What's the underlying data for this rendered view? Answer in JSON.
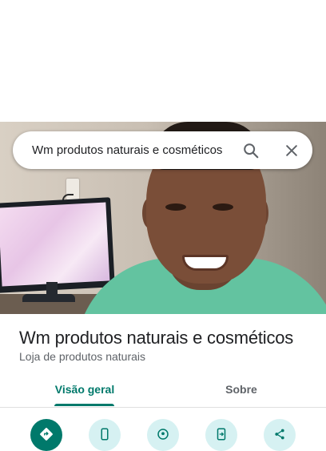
{
  "search": {
    "query": "Wm produtos naturais e cosméticos",
    "search_icon": "search-icon",
    "close_icon": "close-icon"
  },
  "place": {
    "title": "Wm produtos naturais e cosméticos",
    "category": "Loja de produtos naturais"
  },
  "tabs": [
    {
      "label": "Visão geral",
      "selected": true
    },
    {
      "label": "Sobre",
      "selected": false
    }
  ],
  "actions": [
    {
      "icon": "directions-icon"
    },
    {
      "icon": "phone-icon"
    },
    {
      "icon": "location-pin-icon"
    },
    {
      "icon": "send-to-phone-icon"
    },
    {
      "icon": "share-icon"
    }
  ],
  "colors": {
    "accent": "#00796b",
    "action_bg": "#d6f1f2",
    "text_primary": "#202124",
    "text_secondary": "#5f6368"
  }
}
